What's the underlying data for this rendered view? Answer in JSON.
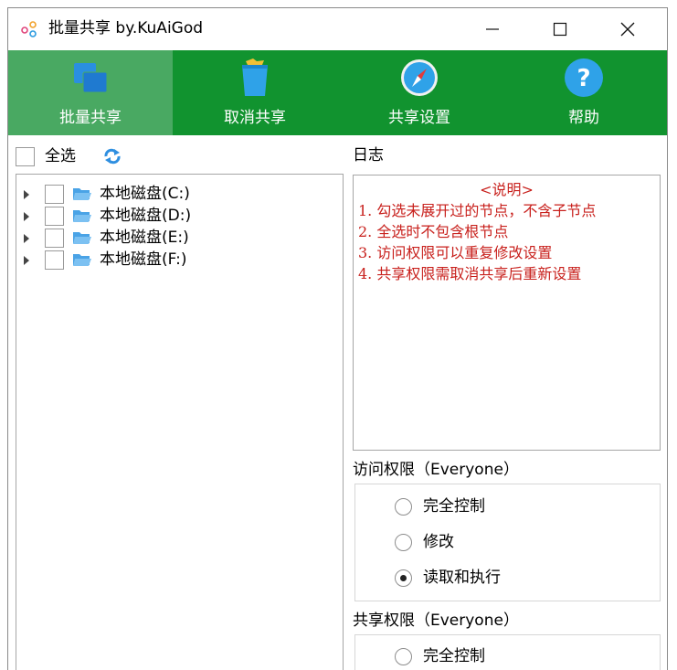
{
  "window": {
    "title": "批量共享 by.KuAiGod"
  },
  "toolbar": {
    "items": [
      {
        "label": "批量共享",
        "icon": "stacked-windows-icon",
        "active": true
      },
      {
        "label": "取消共享",
        "icon": "trash-can-icon",
        "active": false
      },
      {
        "label": "共享设置",
        "icon": "compass-icon",
        "active": false
      },
      {
        "label": "帮助",
        "icon": "help-question-icon",
        "active": false
      }
    ]
  },
  "left": {
    "select_all_label": "全选",
    "drives": [
      {
        "label": "本地磁盘(C:)"
      },
      {
        "label": "本地磁盘(D:)"
      },
      {
        "label": "本地磁盘(E:)"
      },
      {
        "label": "本地磁盘(F:)"
      }
    ]
  },
  "log": {
    "title": "日志",
    "heading": "<说明>",
    "lines": [
      "1. 勾选未展开过的节点，不含子节点",
      "2. 全选时不包含根节点",
      "3. 访问权限可以重复修改设置",
      "4. 共享权限需取消共享后重新设置"
    ]
  },
  "access": {
    "title": "访问权限（Everyone）",
    "options": [
      {
        "label": "完全控制",
        "selected": false
      },
      {
        "label": "修改",
        "selected": false
      },
      {
        "label": "读取和执行",
        "selected": true
      }
    ]
  },
  "share": {
    "title": "共享权限（Everyone）",
    "options": [
      {
        "label": "完全控制",
        "selected": false
      }
    ]
  },
  "colors": {
    "toolbar_bg": "#11932f",
    "toolbar_active": "#49a962",
    "log_text": "#c8201c"
  }
}
